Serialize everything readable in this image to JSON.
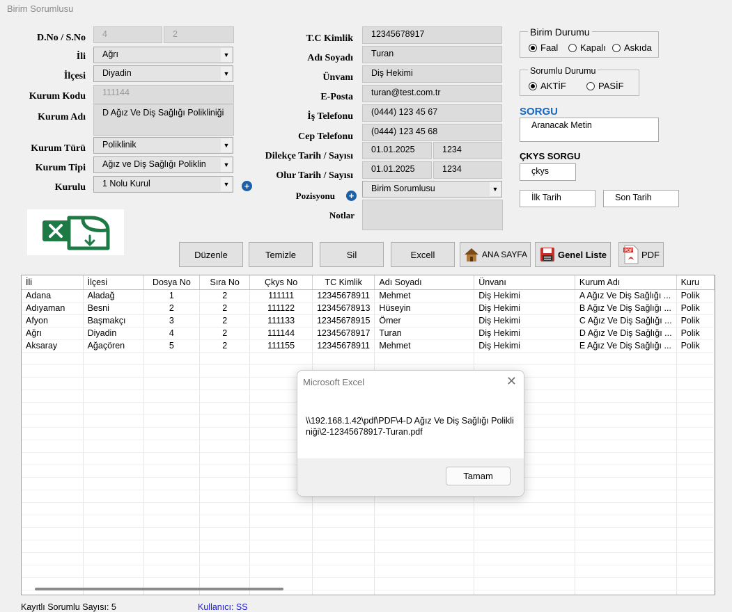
{
  "window": {
    "title": "Birim Sorumlusu"
  },
  "left_form": {
    "dno_label": "D.No / S.No",
    "dno_value": "4",
    "sno_value": "2",
    "il_label": "İli",
    "il_value": "Ağrı",
    "ilce_label": "İlçesi",
    "ilce_value": "Diyadin",
    "kurum_kodu_label": "Kurum Kodu",
    "kurum_kodu_value": "111144",
    "kurum_adi_label": "Kurum Adı",
    "kurum_adi_value": "D Ağız Ve Diş Sağlığı Polikliniği",
    "kurum_turu_label": "Kurum Türü",
    "kurum_turu_value": "Poliklinik",
    "kurum_tipi_label": "Kurum Tipi",
    "kurum_tipi_value": "Ağız ve Diş Sağlığı Poliklin",
    "kurulu_label": "Kurulu",
    "kurulu_value": "1 Nolu Kurul"
  },
  "mid_form": {
    "tc_label": "T.C Kimlik",
    "tc_value": "12345678917",
    "ad_label": "Adı Soyadı",
    "ad_value": "Turan",
    "unvan_label": "Ünvanı",
    "unvan_value": "Diş Hekimi",
    "eposta_label": "E-Posta",
    "eposta_value": "turan@test.com.tr",
    "is_tel_label": "İş Telefonu",
    "is_tel_value": "(0444) 123 45 67",
    "cep_tel_label": "Cep Telefonu",
    "cep_tel_value": "(0444) 123 45 68",
    "dilekce_label": "Dilekçe Tarih / Sayısı",
    "dilekce_tarih": "01.01.2025",
    "dilekce_sayi": "1234",
    "olur_label": "Olur Tarih / Sayısı",
    "olur_tarih": "01.01.2025",
    "olur_sayi": "1234",
    "pozisyon_label": "Pozisyonu",
    "pozisyon_value": "Birim Sorumlusu",
    "notlar_label": "Notlar",
    "notlar_value": ""
  },
  "right_panel": {
    "birim_durumu_title": "Birim Durumu",
    "birim_options": [
      "Faal",
      "Kapalı",
      "Askıda"
    ],
    "birim_selected": "Faal",
    "sorumlu_durumu_title": "Sorumlu Durumu",
    "sorumlu_options": [
      "AKTİF",
      "PASİF"
    ],
    "sorumlu_selected": "AKTİF",
    "sorgu_title": "SORGU",
    "sorgu_value": "Aranacak Metin",
    "ckys_title": "ÇKYS SORGU",
    "ckys_value": "çkys",
    "ilk_tarih": "İlk Tarih",
    "son_tarih": "Son Tarih"
  },
  "toolbar": {
    "duzenle": "Düzenle",
    "temizle": "Temizle",
    "sil": "Sil",
    "excell": "Excell",
    "ana_sayfa": "ANA SAYFA",
    "genel_liste": "Genel Liste",
    "pdf": "PDF"
  },
  "grid": {
    "columns": [
      "İli",
      "İlçesi",
      "Dosya No",
      "Sıra No",
      "Çkys No",
      "TC Kimlik",
      "Adı Soyadı",
      "Ünvanı",
      "Kurum Adı",
      "Kuru"
    ],
    "rows": [
      [
        "Adana",
        "Aladağ",
        "1",
        "2",
        "111111",
        "12345678911",
        "Mehmet",
        "Diş Hekimi",
        "A Ağız Ve Diş Sağlığı ...",
        "Polik"
      ],
      [
        "Adıyaman",
        "Besni",
        "2",
        "2",
        "111122",
        "12345678913",
        "Hüseyin",
        "Diş Hekimi",
        "B Ağız Ve Diş Sağlığı ...",
        "Polik"
      ],
      [
        "Afyon",
        "Başmakçı",
        "3",
        "2",
        "111133",
        "12345678915",
        "Ömer",
        "Diş Hekimi",
        "C Ağız Ve Diş Sağlığı ...",
        "Polik"
      ],
      [
        "Ağrı",
        "Diyadin",
        "4",
        "2",
        "111144",
        "12345678917",
        "Turan",
        "Diş Hekimi",
        "D Ağız Ve Diş Sağlığı ...",
        "Polik"
      ],
      [
        "Aksaray",
        "Ağaçören",
        "5",
        "2",
        "111155",
        "12345678911",
        "Mehmet",
        "Diş Hekimi",
        "E Ağız Ve Diş Sağlığı ...",
        "Polik"
      ]
    ]
  },
  "dialog": {
    "title": "Microsoft Excel",
    "message": "\\\\192.168.1.42\\pdf\\PDF\\4-D Ağız Ve Diş Sağlığı Polikliniği\\2-12345678917-Turan.pdf",
    "ok_label": "Tamam"
  },
  "status": {
    "count_text": "Kayıtlı Sorumlu Sayısı: 5",
    "user_text": "Kullanıcı: SS"
  },
  "colors": {
    "sorgu_title": "#1668c4",
    "user_text": "#1a1ad0",
    "excel_green": "#1e7a45",
    "pdf_red": "#c4302b"
  }
}
